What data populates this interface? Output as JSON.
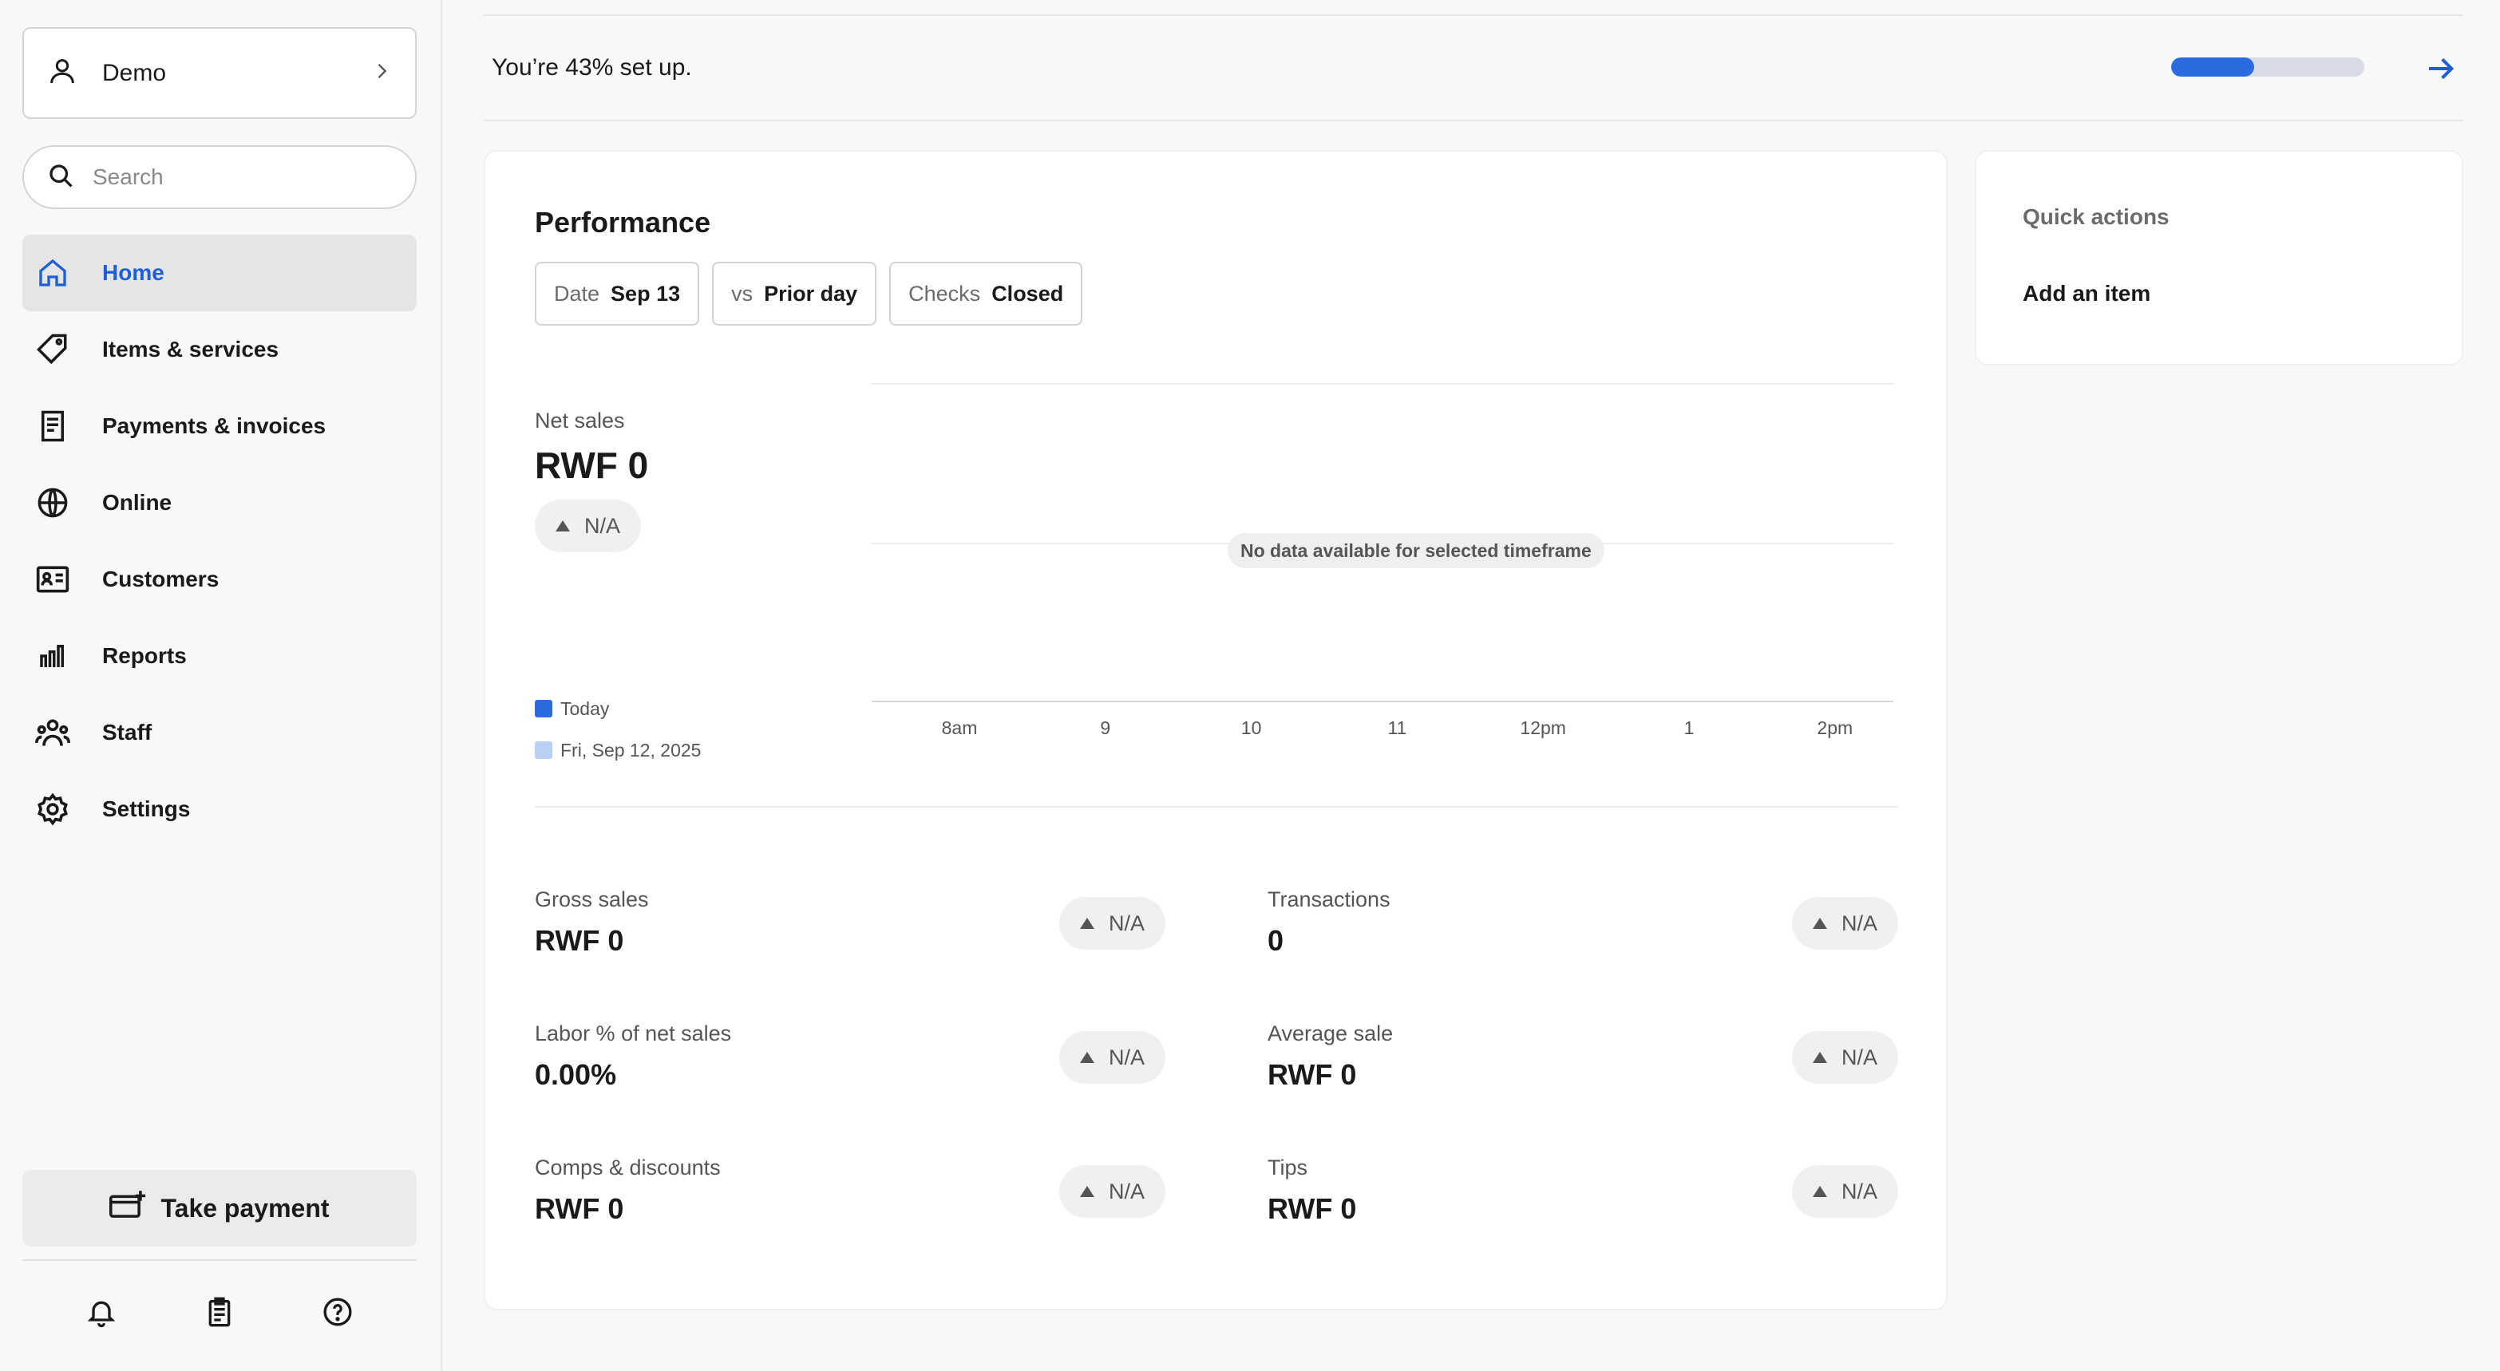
{
  "sidebar": {
    "account": {
      "name": "Demo"
    },
    "search": {
      "placeholder": "Search",
      "value": ""
    },
    "nav": [
      {
        "label": "Home",
        "icon": "home-icon",
        "active": true
      },
      {
        "label": "Items & services",
        "icon": "tag-icon",
        "active": false
      },
      {
        "label": "Payments & invoices",
        "icon": "receipt-icon",
        "active": false
      },
      {
        "label": "Online",
        "icon": "globe-icon",
        "active": false
      },
      {
        "label": "Customers",
        "icon": "id-card-icon",
        "active": false
      },
      {
        "label": "Reports",
        "icon": "bar-chart-icon",
        "active": false
      },
      {
        "label": "Staff",
        "icon": "people-icon",
        "active": false
      },
      {
        "label": "Settings",
        "icon": "gear-icon",
        "active": false
      }
    ],
    "take_payment": {
      "label": "Take payment"
    },
    "footer_icons": [
      "bell-icon",
      "clipboard-icon",
      "help-icon"
    ]
  },
  "setup": {
    "text": "You’re 43% set up.",
    "progress": 0.43
  },
  "performance": {
    "title": "Performance",
    "filters": [
      {
        "key": "Date",
        "value": "Sep 13"
      },
      {
        "key": "vs",
        "value": "Prior day"
      },
      {
        "key": "Checks",
        "value": "Closed"
      }
    ],
    "net_sales": {
      "label": "Net sales",
      "value": "RWF 0",
      "change": "N/A"
    },
    "no_data_text": "No data available for selected timeframe",
    "metrics": [
      {
        "label": "Gross sales",
        "value": "RWF 0",
        "change": "N/A"
      },
      {
        "label": "Transactions",
        "value": "0",
        "change": "N/A"
      },
      {
        "label": "Labor % of net sales",
        "value": "0.00%",
        "change": "N/A"
      },
      {
        "label": "Average sale",
        "value": "RWF 0",
        "change": "N/A"
      },
      {
        "label": "Comps & discounts",
        "value": "RWF 0",
        "change": "N/A"
      },
      {
        "label": "Tips",
        "value": "RWF 0",
        "change": "N/A"
      }
    ]
  },
  "chart_data": {
    "type": "line",
    "x": [
      "8am",
      "9",
      "10",
      "11",
      "12pm",
      "1",
      "2pm"
    ],
    "series": [
      {
        "name": "Today",
        "color": "#2a6be0",
        "values": []
      },
      {
        "name": "Fri, Sep 12, 2025",
        "color": "#b9d0f5",
        "values": []
      }
    ]
  },
  "quick_actions": {
    "title": "Quick actions",
    "items": [
      "Add an item"
    ]
  },
  "colors": {
    "accent": "#1d5fd6",
    "progress": "#2a6be0",
    "legend_prior": "#b9d0f5"
  }
}
